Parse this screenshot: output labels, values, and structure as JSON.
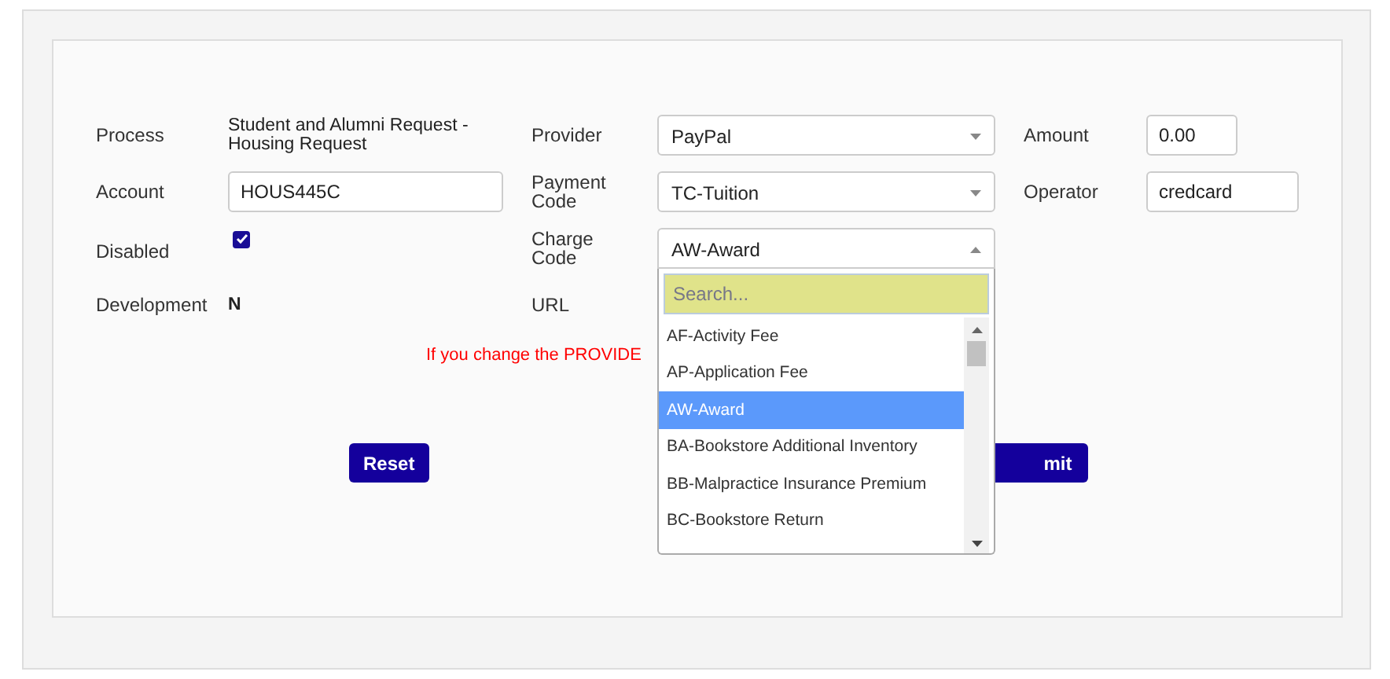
{
  "form": {
    "process": {
      "label": "Process",
      "value": "Student and Alumni Request - Housing Request"
    },
    "provider": {
      "label": "Provider",
      "value": "PayPal"
    },
    "amount": {
      "label": "Amount",
      "value": "0.00"
    },
    "account": {
      "label": "Account",
      "value": "HOUS445C"
    },
    "payment_code": {
      "label": "Payment Code",
      "value": "TC-Tuition"
    },
    "operator": {
      "label": "Operator",
      "value": "credcard"
    },
    "disabled": {
      "label": "Disabled",
      "checked": true
    },
    "charge_code": {
      "label": "Charge Code",
      "value": "AW-Award",
      "expanded": true,
      "search": {
        "placeholder": "Search..."
      },
      "options": [
        {
          "label": "AF-Activity Fee",
          "selected": false
        },
        {
          "label": "AP-Application Fee",
          "selected": false
        },
        {
          "label": "AW-Award",
          "selected": true
        },
        {
          "label": "BA-Bookstore Additional Inventory",
          "selected": false
        },
        {
          "label": "BB-Malpractice Insurance Premium",
          "selected": false
        },
        {
          "label": "BC-Bookstore Return",
          "selected": false
        }
      ]
    },
    "development": {
      "label": "Development",
      "value": "N"
    },
    "url": {
      "label": "URL"
    }
  },
  "message": "If you change the PROVIDE",
  "buttons": {
    "reset": "Reset",
    "submit": "mit"
  }
}
